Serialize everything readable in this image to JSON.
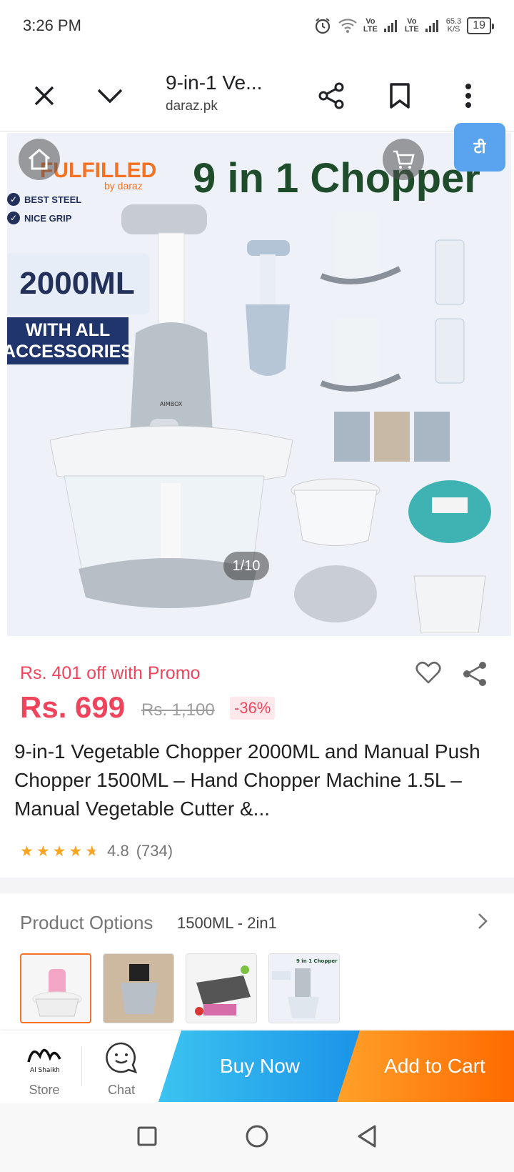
{
  "status": {
    "time": "3:26 PM",
    "net1": "Vo\nLTE",
    "net2": "Vo\nLTE",
    "speed": "65.3\nK/S",
    "battery": "19"
  },
  "browser": {
    "title": "9-in-1 Ve...",
    "domain": "daraz.pk"
  },
  "hero": {
    "fulfilled": "FULFILLED",
    "by": "by daraz",
    "headline": "9 in 1 Chopper",
    "features": [
      "BEST STEEL",
      "NICE GRIP"
    ],
    "badge_volume": "2000ML",
    "badge_accessories": "WITH ALL ACCESSORIES",
    "brand": "AIMBOX",
    "counter": "1/10",
    "translate": "टी"
  },
  "product": {
    "promo": "Rs. 401 off with Promo",
    "price": "Rs. 699",
    "original_price": "Rs. 1,100",
    "discount": "-36%",
    "title": "9-in-1 Vegetable Chopper 2000ML and Manual Push Chopper 1500ML – Hand Chopper Machine 1.5L – Manual Vegetable Cutter &...",
    "rating": 4.8,
    "rating_text": "4.8",
    "rating_count": "(734)"
  },
  "options": {
    "label": "Product Options",
    "selected": "1500ML - 2in1",
    "thumb4_caption": "9 in 1 Chopper"
  },
  "actions": {
    "store": "Store",
    "chat": "Chat",
    "buy_now": "Buy Now",
    "add_to_cart": "Add to Cart",
    "store_logo_text": "Al Shaikh"
  },
  "colors": {
    "accent_orange": "#f57224",
    "price_red": "#f0445c",
    "buy_blue": "#1a94e8",
    "star": "#f6a623"
  }
}
